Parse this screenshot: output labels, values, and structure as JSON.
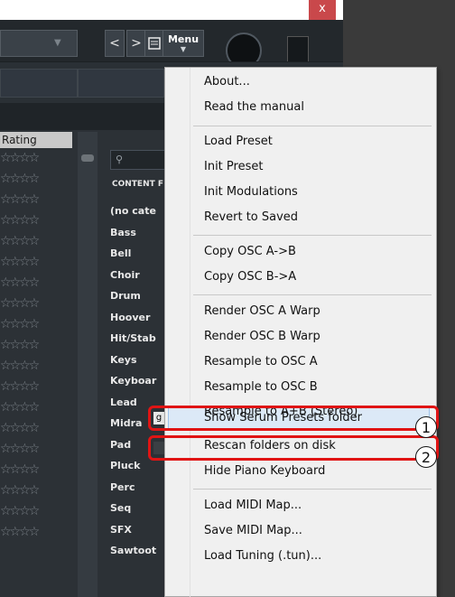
{
  "window": {
    "close_glyph": "x",
    "toolbar": {
      "back_glyph": "<",
      "forward_glyph": ">",
      "menu_label": "Menu",
      "dropdown_glyph": "▼"
    }
  },
  "browser": {
    "rating_header": "Rating",
    "star_glyphs": "☆☆☆☆",
    "search_icon_glyph": "⚲",
    "category_header": "CONTENT F",
    "categories": [
      "(no cate",
      "Bass",
      "Bell",
      "Choir",
      "Drum",
      "Hoover",
      "Hit/Stab",
      "Keys",
      "Keyboar",
      "Lead",
      "Midra",
      "Pad",
      "Pluck",
      "Perc",
      "Seq",
      "SFX",
      "Sawtoot"
    ]
  },
  "menu": {
    "items": [
      "About...",
      "Read the manual",
      "Load Preset",
      "Init Preset",
      "Init Modulations",
      "Revert to Saved",
      "Copy OSC A->B",
      "Copy OSC B->A",
      "Render OSC A Warp",
      "Render OSC B Warp",
      "Resample to OSC A",
      "Resample to OSC B",
      "Resample to A+B (Stereo)",
      "Show Serum Presets folder",
      "Rescan folders on disk",
      "Hide Piano Keyboard",
      "Load MIDI Map...",
      "Save MIDI Map...",
      "Load Tuning (.tun)..."
    ],
    "highlighted_item": "Show Serum Presets folder"
  },
  "annotations": {
    "label_1": "1",
    "label_2": "2",
    "callout_color": "#e01414"
  }
}
